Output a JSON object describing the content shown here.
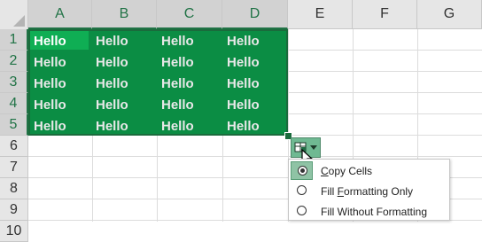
{
  "columns": [
    "A",
    "B",
    "C",
    "D",
    "E",
    "F",
    "G"
  ],
  "rows": [
    "1",
    "2",
    "3",
    "4",
    "5",
    "6",
    "7",
    "8",
    "9",
    "10"
  ],
  "cells": [
    [
      "Hello",
      "Hello",
      "Hello",
      "Hello"
    ],
    [
      "Hello",
      "Hello",
      "Hello",
      "Hello"
    ],
    [
      "Hello",
      "Hello",
      "Hello",
      "Hello"
    ],
    [
      "Hello",
      "Hello",
      "Hello",
      "Hello"
    ],
    [
      "Hello",
      "Hello",
      "Hello",
      "Hello"
    ]
  ],
  "colors": {
    "selection_fill": "#0b8d44",
    "selection_border": "#1a6b3c",
    "active_cell": "#0fae54",
    "header_selected_text": "#217346",
    "autofill_button": "#6fb992"
  },
  "autofill_menu": {
    "items": [
      {
        "label_pre": "",
        "label_u": "C",
        "label_post": "opy Cells",
        "selected": true
      },
      {
        "label_pre": "Fill ",
        "label_u": "F",
        "label_post": "ormatting Only",
        "selected": false
      },
      {
        "label_pre": "Fill Without Formatting",
        "label_u": "",
        "label_post": "",
        "selected": false
      }
    ]
  },
  "icons": {
    "autofill": "autofill-options-icon",
    "cursor": "mouse-pointer-icon"
  }
}
